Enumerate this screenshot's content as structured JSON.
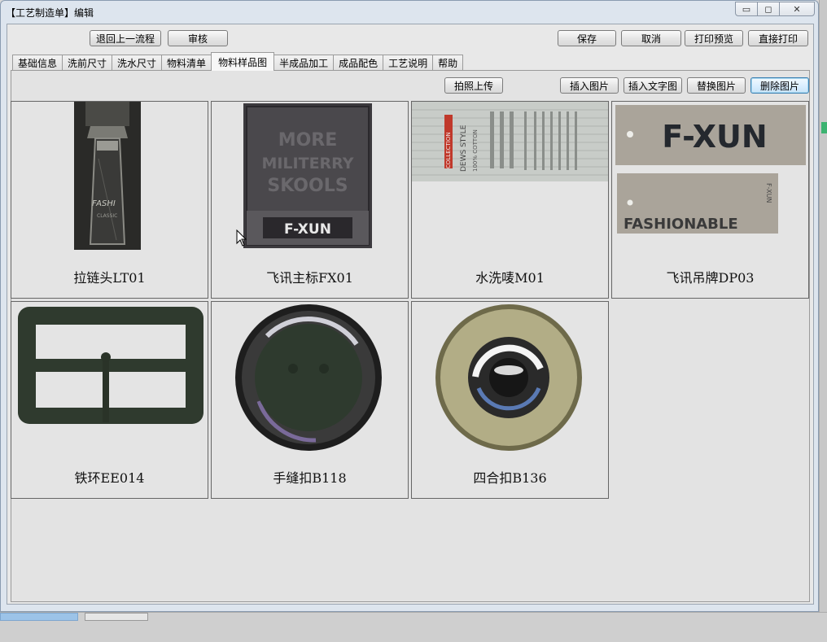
{
  "window": {
    "title": "【工艺制造单】编辑",
    "controls": {
      "minimize": "▭",
      "maximize": "◻",
      "close": "✕"
    }
  },
  "toolbar": {
    "back_label": "退回上一流程",
    "review_label": "审核",
    "save_label": "保存",
    "cancel_label": "取消",
    "print_preview_label": "打印预览",
    "print_direct_label": "直接打印"
  },
  "tabs": [
    {
      "label": "基础信息"
    },
    {
      "label": "洗前尺寸"
    },
    {
      "label": "洗水尺寸"
    },
    {
      "label": "物料清单"
    },
    {
      "label": "物料样品图",
      "active": true
    },
    {
      "label": "半成品加工"
    },
    {
      "label": "成品配色"
    },
    {
      "label": "工艺说明"
    },
    {
      "label": "帮助"
    }
  ],
  "panel_actions": {
    "photo_upload_label": "拍照上传",
    "insert_image_label": "插入图片",
    "insert_text_image_label": "插入文字图",
    "replace_image_label": "替换图片",
    "delete_image_label": "删除图片"
  },
  "samples": [
    {
      "caption": "拉链头LT01",
      "image_text": [
        "FASHI",
        "CLASSIC"
      ]
    },
    {
      "caption": "飞讯主标FX01",
      "image_text": [
        "MORE",
        "MILITERRY",
        "SKOOLS",
        "F-XUN"
      ]
    },
    {
      "caption": "水洗唛M01",
      "image_text": [
        "COLLECTION",
        "DEWS STYLE",
        "100% COTTON"
      ]
    },
    {
      "caption": "飞讯吊牌DP03",
      "image_text": [
        "F-XUN",
        "FASHIONABLE",
        "F-XUN"
      ]
    },
    {
      "caption": "铁环EE014"
    },
    {
      "caption": "手缝扣B118"
    },
    {
      "caption": "四合扣B136"
    }
  ],
  "colors": {
    "window_frame": "#dde5ee",
    "client_bg": "#e8e8e8",
    "focus_border": "#3c7fb1"
  }
}
